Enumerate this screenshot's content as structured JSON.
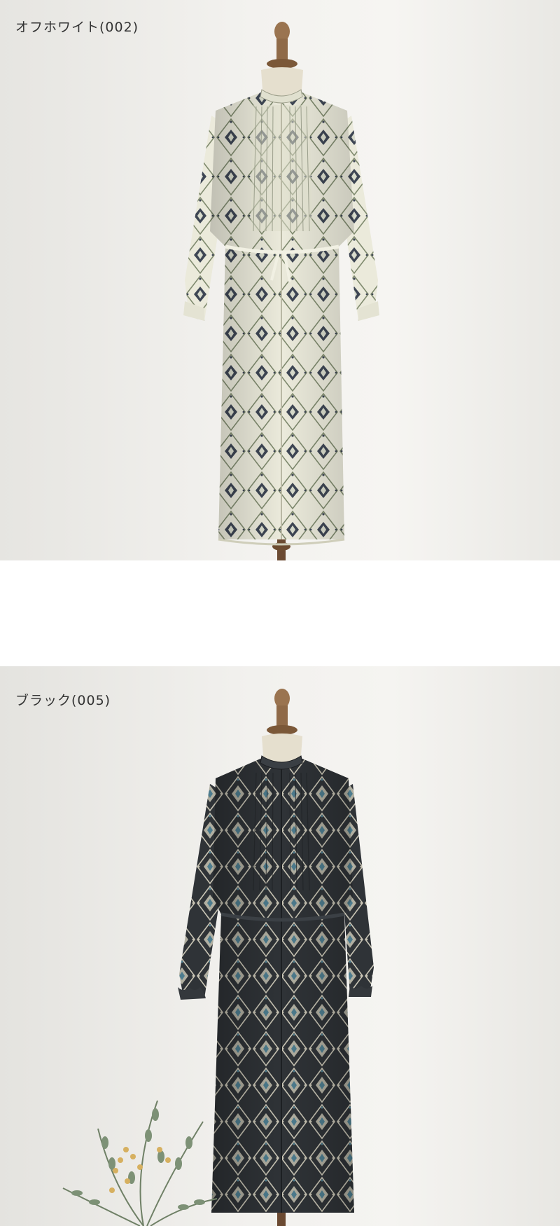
{
  "products": [
    {
      "color_label": "オフホワイト(002)",
      "icon": "offwhite-dress-photo",
      "dress_color": "#e9e8d6",
      "pattern_color": "#3e4654",
      "background": "#efeeea"
    },
    {
      "color_label": "ブラック(005)",
      "icon": "black-dress-photo",
      "dress_color": "#2f3337",
      "pattern_color": "#c8c4b4",
      "accent_color": "#4d7c8e",
      "background": "#efeeea"
    }
  ]
}
